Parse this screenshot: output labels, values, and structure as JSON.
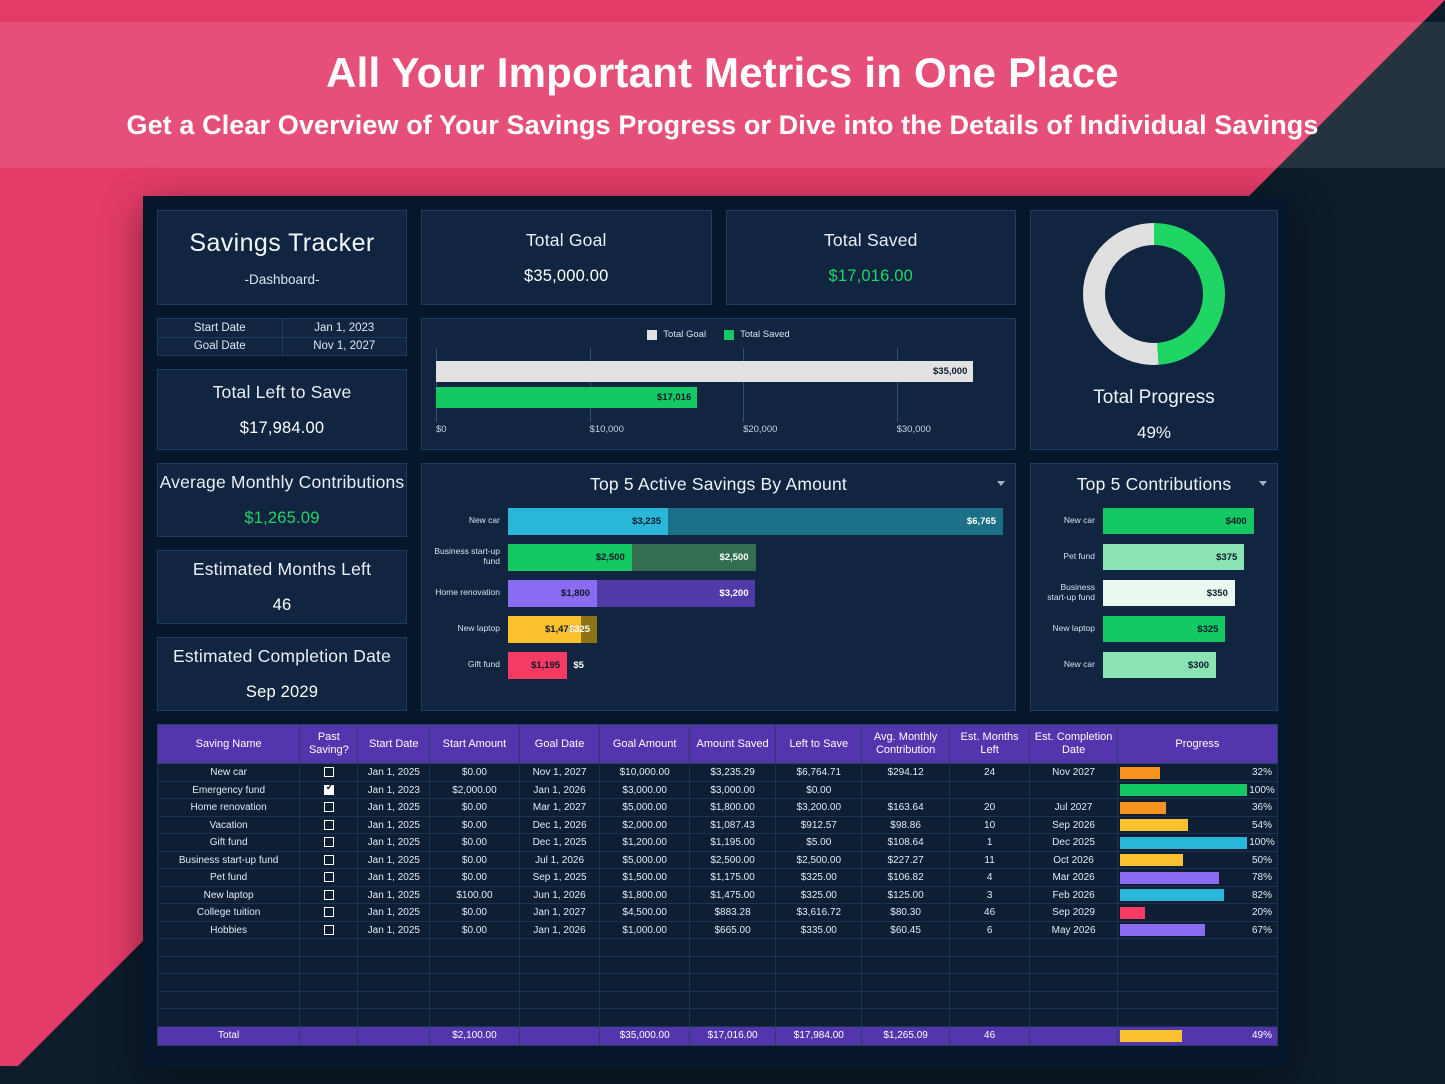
{
  "banner": {
    "title": "All Your Important Metrics in One Place",
    "subtitle": "Get a Clear Overview of Your Savings Progress or Dive into the Details of Individual Savings"
  },
  "colors": {
    "pink": "#e43c68",
    "dark": "#0d1b2a",
    "panel": "#112440",
    "green": "#1fd665",
    "purple_header": "#5336ae",
    "cyan": "#29b6d8",
    "yellow": "#fbc02d",
    "orange": "#f7931e",
    "violet": "#8b6bf2",
    "rose": "#f53a63"
  },
  "title_card": {
    "title": "Savings Tracker",
    "subtitle": "-Dashboard-"
  },
  "date_table": {
    "rows": [
      {
        "label": "Start Date",
        "value": "Jan 1, 2023"
      },
      {
        "label": "Goal Date",
        "value": "Nov 1, 2027"
      }
    ]
  },
  "kpis": {
    "total_left": {
      "title": "Total Left to Save",
      "value": "$17,984.00"
    },
    "avg_monthly": {
      "title": "Average Monthly Contributions",
      "value": "$1,265.09"
    },
    "months_left": {
      "title": "Estimated Months Left",
      "value": "46"
    },
    "completion": {
      "title": "Estimated Completion Date",
      "value": "Sep 2029"
    },
    "total_goal": {
      "title": "Total Goal",
      "value": "$35,000.00"
    },
    "total_saved": {
      "title": "Total Saved",
      "value": "$17,016.00"
    }
  },
  "donut": {
    "title": "Total Progress",
    "value": "49%",
    "percent": 49
  },
  "chart_data": [
    {
      "type": "bar",
      "title": "",
      "orientation": "horizontal",
      "legend": [
        {
          "label": "Total Goal",
          "color": "#e2e2e2"
        },
        {
          "label": "Total Saved",
          "color": "#14c863"
        }
      ],
      "categories": [
        "Total Goal",
        "Total Saved"
      ],
      "values": [
        35000,
        17016
      ],
      "data_labels": [
        "$35,000",
        "$17,016"
      ],
      "xlabel": "",
      "ylabel": "",
      "xlim": [
        0,
        36800
      ],
      "ticks": [
        "$0",
        "$10,000",
        "$20,000",
        "$30,000"
      ],
      "tick_values": [
        0,
        10000,
        20000,
        30000
      ],
      "grid": true,
      "legend_position": "top"
    },
    {
      "type": "bar",
      "title": "Top 5 Active Savings By Amount",
      "orientation": "horizontal",
      "stacked": true,
      "categories": [
        "New car",
        "Business start-up fund",
        "Home renovation",
        "New laptop",
        "Gift fund"
      ],
      "series": [
        {
          "name": "Amount Saved",
          "values": [
            3235,
            2500,
            1800,
            1475,
            1195
          ],
          "labels": [
            "$3,235",
            "$2,500",
            "$1,800",
            "$1,475",
            "$1,195"
          ],
          "colors": [
            "#29b6d8",
            "#14c863",
            "#8b6bf2",
            "#fbc02d",
            "#f53a63"
          ]
        },
        {
          "name": "Left to Save",
          "values": [
            6765,
            2500,
            3200,
            325,
            5
          ],
          "labels": [
            "$6,765",
            "$2,500",
            "$3,200",
            "$325",
            "$5"
          ],
          "colors": [
            "#1b6f86",
            "#336e51",
            "#503aa8",
            "#8a7414",
            "#0d1b2a"
          ]
        }
      ],
      "xlim": [
        0,
        10000
      ],
      "grid": false,
      "legend_position": "none"
    },
    {
      "type": "bar",
      "title": "Top 5 Contributions",
      "orientation": "horizontal",
      "categories": [
        "New car",
        "Pet fund",
        "Business start-up fund",
        "New laptop",
        "New car"
      ],
      "values": [
        400,
        375,
        350,
        325,
        300
      ],
      "labels": [
        "$400",
        "$375",
        "$350",
        "$325",
        "$300"
      ],
      "colors": [
        "#14c863",
        "#8ae3b3",
        "#eaf8ef",
        "#14c863",
        "#8ae3b3"
      ],
      "xlim": [
        0,
        430
      ],
      "grid": false,
      "legend_position": "none"
    }
  ],
  "table": {
    "headers": [
      "Saving Name",
      "Past Saving?",
      "Start Date",
      "Start Amount",
      "Goal Date",
      "Goal Amount",
      "Amount Saved",
      "Left to Save",
      "Avg. Monthly Contribution",
      "Est. Months Left",
      "Est. Completion Date",
      "Progress"
    ],
    "rows": [
      {
        "name": "New car",
        "past": false,
        "start_date": "Jan 1, 2025",
        "start_amount": "$0.00",
        "goal_date": "Nov 1, 2027",
        "goal_amount": "$10,000.00",
        "saved": "$3,235.29",
        "left": "$6,764.71",
        "avg": "$294.12",
        "months": "24",
        "completion": "Nov 2027",
        "progress_pct": "32%",
        "progress": 32,
        "bar_color": "#f7931e"
      },
      {
        "name": "Emergency fund",
        "past": true,
        "start_date": "Jan 1, 2023",
        "start_amount": "$2,000.00",
        "goal_date": "Jan 1, 2026",
        "goal_amount": "$3,000.00",
        "saved": "$3,000.00",
        "left": "$0.00",
        "avg": "",
        "months": "",
        "completion": "",
        "progress_pct": "100%",
        "progress": 100,
        "bar_color": "#14c863"
      },
      {
        "name": "Home renovation",
        "past": false,
        "start_date": "Jan 1, 2025",
        "start_amount": "$0.00",
        "goal_date": "Mar 1, 2027",
        "goal_amount": "$5,000.00",
        "saved": "$1,800.00",
        "left": "$3,200.00",
        "avg": "$163.64",
        "months": "20",
        "completion": "Jul 2027",
        "progress_pct": "36%",
        "progress": 36,
        "bar_color": "#f7931e"
      },
      {
        "name": "Vacation",
        "past": false,
        "start_date": "Jan 1, 2025",
        "start_amount": "$0.00",
        "goal_date": "Dec 1, 2026",
        "goal_amount": "$2,000.00",
        "saved": "$1,087.43",
        "left": "$912.57",
        "avg": "$98.86",
        "months": "10",
        "completion": "Sep 2026",
        "progress_pct": "54%",
        "progress": 54,
        "bar_color": "#fbc02d"
      },
      {
        "name": "Gift fund",
        "past": false,
        "start_date": "Jan 1, 2025",
        "start_amount": "$0.00",
        "goal_date": "Dec 1, 2025",
        "goal_amount": "$1,200.00",
        "saved": "$1,195.00",
        "left": "$5.00",
        "avg": "$108.64",
        "months": "1",
        "completion": "Dec 2025",
        "progress_pct": "100%",
        "progress": 100,
        "bar_color": "#29b6d8"
      },
      {
        "name": "Business start-up fund",
        "past": false,
        "start_date": "Jan 1, 2025",
        "start_amount": "$0.00",
        "goal_date": "Jul 1, 2026",
        "goal_amount": "$5,000.00",
        "saved": "$2,500.00",
        "left": "$2,500.00",
        "avg": "$227.27",
        "months": "11",
        "completion": "Oct 2026",
        "progress_pct": "50%",
        "progress": 50,
        "bar_color": "#fbc02d"
      },
      {
        "name": "Pet fund",
        "past": false,
        "start_date": "Jan 1, 2025",
        "start_amount": "$0.00",
        "goal_date": "Sep 1, 2025",
        "goal_amount": "$1,500.00",
        "saved": "$1,175.00",
        "left": "$325.00",
        "avg": "$106.82",
        "months": "4",
        "completion": "Mar 2026",
        "progress_pct": "78%",
        "progress": 78,
        "bar_color": "#8b6bf2"
      },
      {
        "name": "New laptop",
        "past": false,
        "start_date": "Jan 1, 2025",
        "start_amount": "$100.00",
        "goal_date": "Jun 1, 2026",
        "goal_amount": "$1,800.00",
        "saved": "$1,475.00",
        "left": "$325.00",
        "avg": "$125.00",
        "months": "3",
        "completion": "Feb 2026",
        "progress_pct": "82%",
        "progress": 82,
        "bar_color": "#29b6d8"
      },
      {
        "name": "College tuition",
        "past": false,
        "start_date": "Jan 1, 2025",
        "start_amount": "$0.00",
        "goal_date": "Jan 1, 2027",
        "goal_amount": "$4,500.00",
        "saved": "$883.28",
        "left": "$3,616.72",
        "avg": "$80.30",
        "months": "46",
        "completion": "Sep 2029",
        "progress_pct": "20%",
        "progress": 20,
        "bar_color": "#f53a63"
      },
      {
        "name": "Hobbies",
        "past": false,
        "start_date": "Jan 1, 2025",
        "start_amount": "$0.00",
        "goal_date": "Jan 1, 2026",
        "goal_amount": "$1,000.00",
        "saved": "$665.00",
        "left": "$335.00",
        "avg": "$60.45",
        "months": "6",
        "completion": "May 2026",
        "progress_pct": "67%",
        "progress": 67,
        "bar_color": "#8b6bf2"
      }
    ],
    "empty_rows": 5,
    "total": {
      "name": "Total",
      "past": "",
      "start_date": "",
      "start_amount": "$2,100.00",
      "goal_date": "",
      "goal_amount": "$35,000.00",
      "saved": "$17,016.00",
      "left": "$17,984.00",
      "avg": "$1,265.09",
      "months": "46",
      "completion": "",
      "progress_pct": "49%",
      "progress": 49,
      "bar_color": "#fbc02d"
    }
  }
}
